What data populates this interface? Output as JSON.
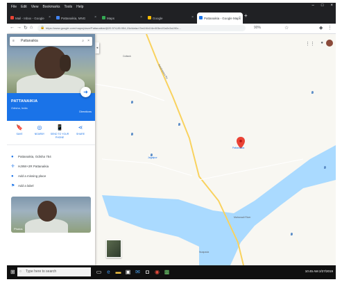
{
  "browser": {
    "menu": [
      "File",
      "Edit",
      "View",
      "Bookmarks",
      "Tools",
      "Help"
    ],
    "window_controls": [
      "–",
      "□",
      "×"
    ],
    "tabs": [
      {
        "label": "Mail - Inbox - Google",
        "favicon_color": "#ea4335"
      },
      {
        "label": "Pattanaikia, MNG",
        "favicon_color": "#4285f4"
      },
      {
        "label": "Maps",
        "favicon_color": "#34a853"
      },
      {
        "label": "Google",
        "favicon_color": "#fbbc04"
      },
      {
        "label": "Pattanaikia - Google Maps",
        "favicon_color": "#1a73e8",
        "active": true
      }
    ],
    "new_tab": "+",
    "url": "https://www.google.com/maps/place/Pattanaikia/@20.574,85.954,15z/data=!3m1!4b1!4m5!3m4!1s0x3a190c...",
    "zoom": "90%"
  },
  "sidebar": {
    "search_value": "Pattanaikia",
    "place_name": "PATTANAIKIA",
    "place_subtitle": "Odisha, India",
    "directions_label": "Directions",
    "actions": [
      {
        "icon": "save-icon",
        "glyph": "🔖",
        "label": "SAVE"
      },
      {
        "icon": "nearby-icon",
        "glyph": "◎",
        "label": "NEARBY"
      },
      {
        "icon": "phone-icon",
        "glyph": "📱",
        "label": "SEND TO YOUR PHONE"
      },
      {
        "icon": "share-icon",
        "glyph": "⋖",
        "label": "SHARE"
      }
    ],
    "info": [
      {
        "icon": "location-icon",
        "glyph": "●",
        "text": "Pattanaikia, Odisha 754"
      },
      {
        "icon": "plus-code-icon",
        "glyph": "✛",
        "text": "HJ8W+2R Pattanaikia"
      },
      {
        "icon": "add-place-icon",
        "glyph": "●",
        "text": "Add a missing place"
      },
      {
        "icon": "label-icon",
        "glyph": "⚑",
        "text": "Add a label"
      }
    ],
    "photos_label": "Photos"
  },
  "map": {
    "labels": [
      {
        "text": "Pattanaikia",
        "blue": true
      },
      {
        "text": "Cuttack"
      },
      {
        "text": "Mahanadi River"
      },
      {
        "text": "Kendrapara Rd"
      },
      {
        "text": "Jagatpur"
      },
      {
        "text": "Nuapada"
      }
    ],
    "water_color": "#aadaff",
    "road_color": "#f9d25e",
    "pin_color": "#ea4335"
  },
  "taskbar": {
    "search_placeholder": "Type here to search",
    "time": "10:45 AM",
    "date": "2/27/2019"
  }
}
